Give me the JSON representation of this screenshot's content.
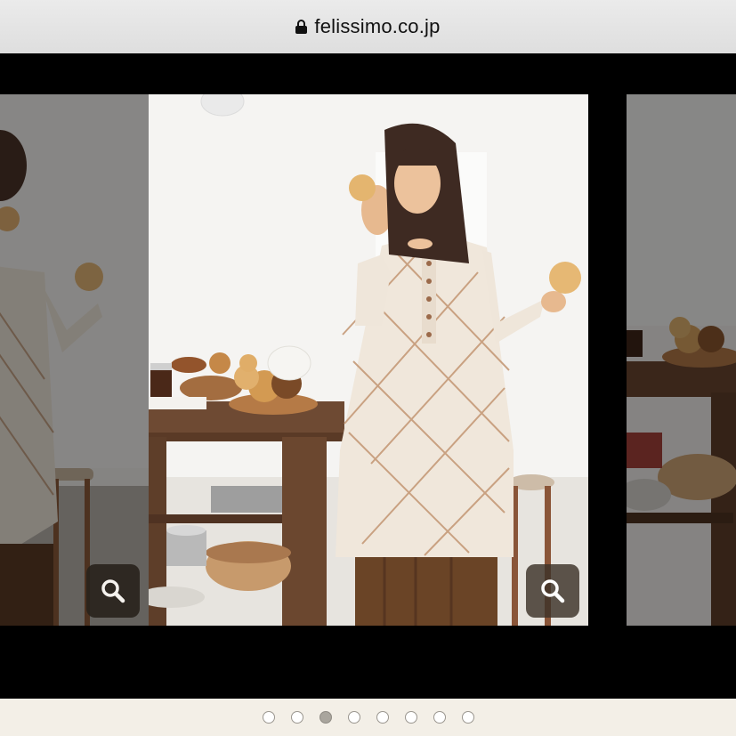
{
  "address_bar": {
    "url": "felissimo.co.jp",
    "secure_icon": "lock-icon"
  },
  "carousel": {
    "slide_count": 8,
    "active_index": 2,
    "zoom_icon": "magnifier-icon"
  },
  "colors": {
    "pager_bg": "#f3efe7",
    "dot_active": "#a9a59d",
    "stage_bg": "#000000"
  }
}
